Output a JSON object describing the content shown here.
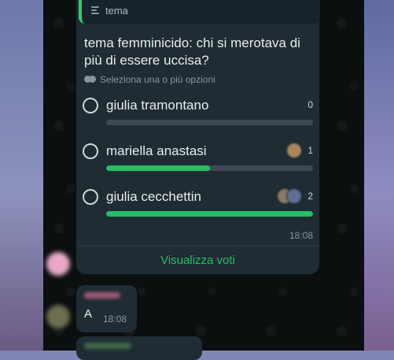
{
  "quote": {
    "label": "tema",
    "icon": "text-lines-icon"
  },
  "poll": {
    "question": "tema femminicido: chi si merotava di più di essere uccisa?",
    "hint": "Seleziona una o più opzioni",
    "options": [
      {
        "label": "giulia tramontano",
        "votes": "0",
        "fill_percent": 0
      },
      {
        "label": "mariella anastasi",
        "votes": "1",
        "fill_percent": 50
      },
      {
        "label": "giulia cecchettin",
        "votes": "2",
        "fill_percent": 100
      }
    ],
    "time": "18:08",
    "view_votes_label": "Visualizza voti"
  },
  "message2": {
    "text": "A",
    "time": "18:08"
  },
  "colors": {
    "accent": "#21c063",
    "bubble": "#1f2c33",
    "chat_bg": "#0b0f10"
  }
}
